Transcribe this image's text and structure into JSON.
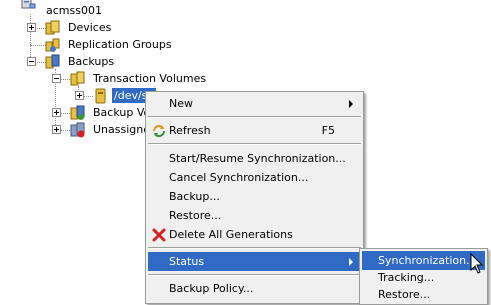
{
  "tree": {
    "root_label": "acmss001",
    "nodes": [
      {
        "label": "Devices",
        "icon": "devices-icon",
        "expander": "plus"
      },
      {
        "label": "Replication Groups",
        "icon": "replication-groups-icon",
        "expander": "none"
      },
      {
        "label": "Backups",
        "icon": "backups-icon",
        "expander": "minus"
      },
      {
        "label": "Transaction Volumes",
        "icon": "transaction-volumes-icon",
        "expander": "minus"
      },
      {
        "label": "/dev/sfl",
        "icon": "volume-icon",
        "expander": "plus"
      },
      {
        "label": "Backup Volu",
        "icon": "backup-volumes-icon",
        "expander": "plus"
      },
      {
        "label": "Unassigned",
        "icon": "unassigned-volumes-icon",
        "expander": "plus"
      }
    ]
  },
  "context_menu": {
    "items": [
      {
        "label": "New",
        "submenu": true
      },
      {
        "label": "Refresh",
        "shortcut": "F5",
        "icon": "refresh-icon"
      },
      {
        "label": "Start/Resume Synchronization..."
      },
      {
        "label": "Cancel Synchronization..."
      },
      {
        "label": "Backup..."
      },
      {
        "label": "Restore..."
      },
      {
        "label": "Delete All Generations",
        "icon": "delete-icon"
      },
      {
        "label": "Status",
        "submenu": true,
        "highlighted": true
      },
      {
        "label": "Backup Policy..."
      }
    ]
  },
  "status_submenu": {
    "items": [
      {
        "label": "Synchronization...",
        "highlighted": true
      },
      {
        "label": "Tracking..."
      },
      {
        "label": "Restore..."
      }
    ]
  },
  "colors": {
    "selection": "#316ac5",
    "menu_background": "#f0f0f0",
    "folder_yellow": "#e8c040"
  }
}
